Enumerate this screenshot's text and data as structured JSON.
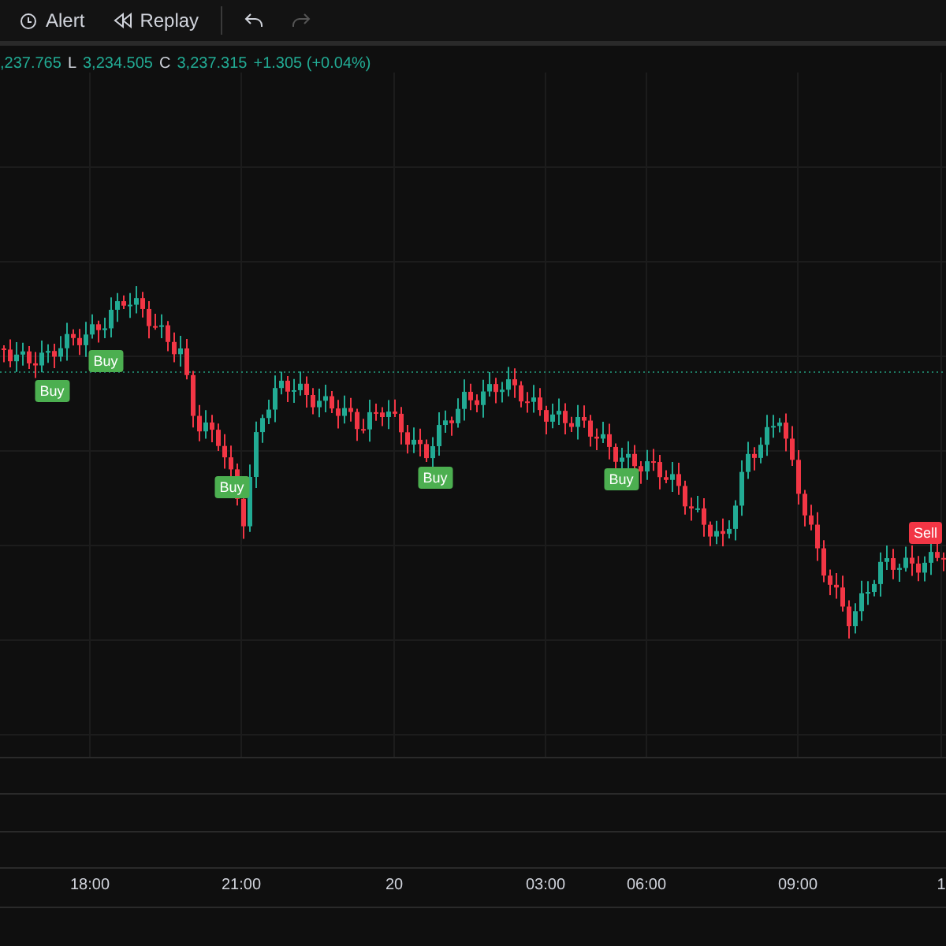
{
  "toolbar": {
    "buttons": [
      {
        "kind": "alert",
        "label": "Alert"
      },
      {
        "kind": "replay",
        "label": "Replay"
      },
      {
        "kind": "undo",
        "disabled": false
      },
      {
        "kind": "redo",
        "disabled": true
      }
    ]
  },
  "legend": {
    "high": ",237.765",
    "low_prefix": "L",
    "low": "3,234.505",
    "close_prefix": "C",
    "close": "3,237.315",
    "change": "+1.305 (+0.04%)"
  },
  "signals": [
    {
      "kind": "buy",
      "label": "Buy"
    },
    {
      "kind": "buy",
      "label": "Buy"
    },
    {
      "kind": "buy",
      "label": "Buy"
    },
    {
      "kind": "buy",
      "label": "Buy"
    },
    {
      "kind": "buy",
      "label": "Buy"
    },
    {
      "kind": "sell",
      "label": "Sell"
    }
  ],
  "time_axis": [
    "18:00",
    "21:00",
    "20",
    "03:00",
    "06:00",
    "09:00",
    "1"
  ]
}
